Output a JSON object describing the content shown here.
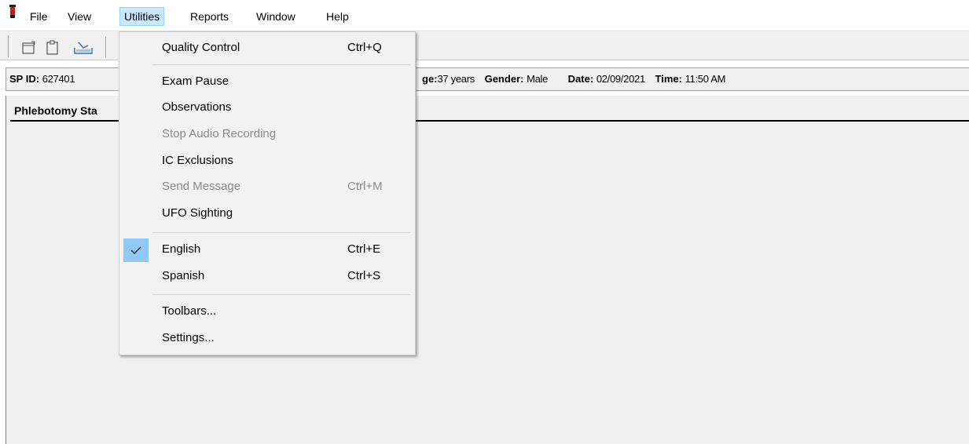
{
  "menubar": {
    "items": [
      "File",
      "View",
      "Utilities",
      "Reports",
      "Window",
      "Help"
    ],
    "active": "Utilities"
  },
  "toolbar": {
    "buttons": [
      "new-window-icon",
      "clipboard-icon",
      "import-icon"
    ]
  },
  "infobar": {
    "spid_label": "SP ID:",
    "spid_value": "627401",
    "age_label": "ge:",
    "age_value": "37 years",
    "gender_label": "Gender:",
    "gender_value": "Male",
    "date_label": "Date:",
    "date_value": "02/09/2021",
    "time_label": "Time:",
    "time_value": "11:50 AM"
  },
  "panel": {
    "title": "Phlebotomy Sta"
  },
  "utilities_menu": {
    "items": [
      {
        "label": "Quality Control",
        "shortcut": "Ctrl+Q"
      },
      {
        "label": "Exam Pause",
        "shortcut": ""
      },
      {
        "label": "Observations",
        "shortcut": ""
      },
      {
        "label": "Stop Audio Recording",
        "shortcut": "",
        "disabled": true
      },
      {
        "label": "IC Exclusions",
        "shortcut": ""
      },
      {
        "label": "Send Message",
        "shortcut": "Ctrl+M",
        "disabled": true
      },
      {
        "label": "UFO Sighting",
        "shortcut": ""
      },
      {
        "label": "English",
        "shortcut": "Ctrl+E",
        "checked": true
      },
      {
        "label": "Spanish",
        "shortcut": "Ctrl+S"
      },
      {
        "label": "Toolbars...",
        "shortcut": ""
      },
      {
        "label": "Settings...",
        "shortcut": ""
      }
    ]
  },
  "colors": {
    "menu_highlight": "#cce8ff",
    "check_highlight": "#90c8f6",
    "disabled_text": "#8a8a8a",
    "panel_bg": "#f0f0f0"
  }
}
